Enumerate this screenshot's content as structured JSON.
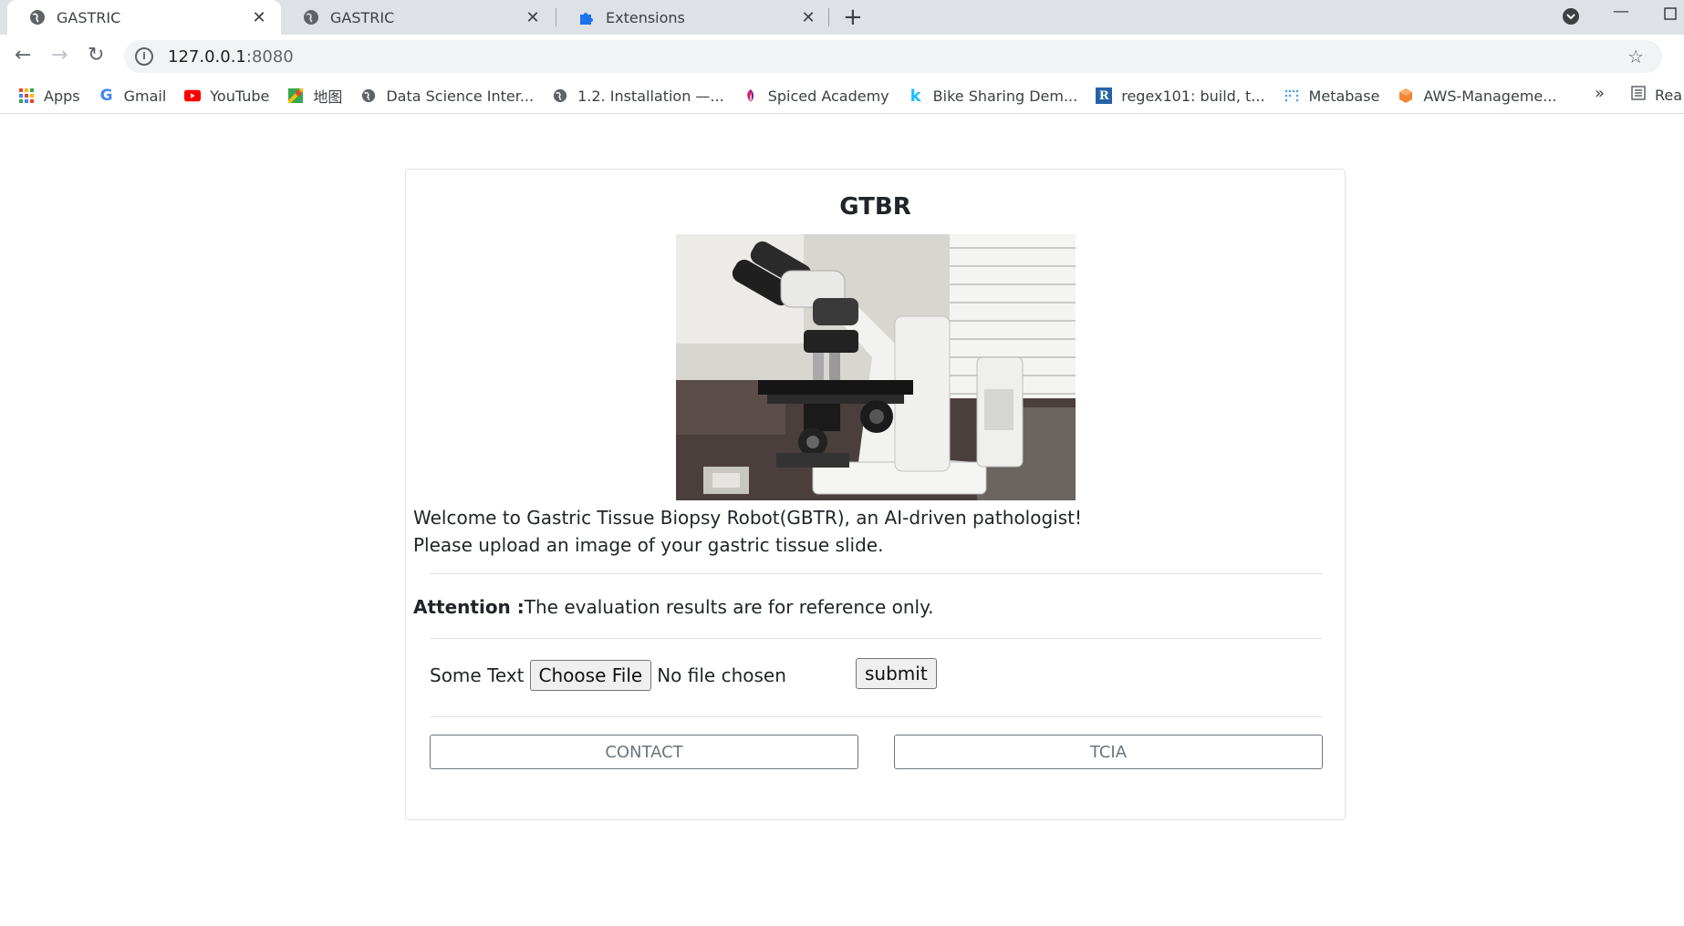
{
  "browser": {
    "tabs": [
      {
        "title": "GASTRIC",
        "icon": "globe-icon",
        "active": true
      },
      {
        "title": "GASTRIC",
        "icon": "globe-icon",
        "active": false
      },
      {
        "title": "Extensions",
        "icon": "puzzle-icon",
        "active": false
      }
    ],
    "url_host": "127.0.0.1",
    "url_port": ":8080",
    "bookmarks": [
      {
        "label": "Apps",
        "icon": "apps-grid-icon"
      },
      {
        "label": "Gmail",
        "icon": "google-g-icon"
      },
      {
        "label": "YouTube",
        "icon": "youtube-icon"
      },
      {
        "label": "地图",
        "icon": "maps-icon"
      },
      {
        "label": "Data Science Inter...",
        "icon": "globe-icon"
      },
      {
        "label": "1.2. Installation —...",
        "icon": "globe-icon"
      },
      {
        "label": "Spiced Academy",
        "icon": "spiced-icon"
      },
      {
        "label": "Bike Sharing Dem...",
        "icon": "kaggle-k-icon"
      },
      {
        "label": "regex101: build, t...",
        "icon": "regex-r-icon"
      },
      {
        "label": "Metabase",
        "icon": "metabase-icon"
      },
      {
        "label": "AWS-Manageme...",
        "icon": "aws-cube-icon"
      }
    ],
    "more_bookmarks": "»",
    "reading_list": "Rea"
  },
  "page": {
    "title": "GTBR",
    "hero_image": "microscope-photo",
    "welcome_line1": "Welcome to Gastric Tissue Biopsy Robot(GBTR), an AI-driven pathologist!",
    "welcome_line2": "Please upload an image of your gastric tissue slide.",
    "attention_label": "Attention :",
    "attention_text": "The evaluation results are for reference only.",
    "upload_label": "Some Text",
    "choose_file_label": "Choose File",
    "file_status": "No file chosen",
    "submit_label": "submit",
    "contact_label": "CONTACT",
    "tcia_label": "TCIA"
  },
  "colors": {
    "tabstrip_bg": "#dee1e6",
    "border": "#dee2e6",
    "outline_button": "#6c757d"
  }
}
